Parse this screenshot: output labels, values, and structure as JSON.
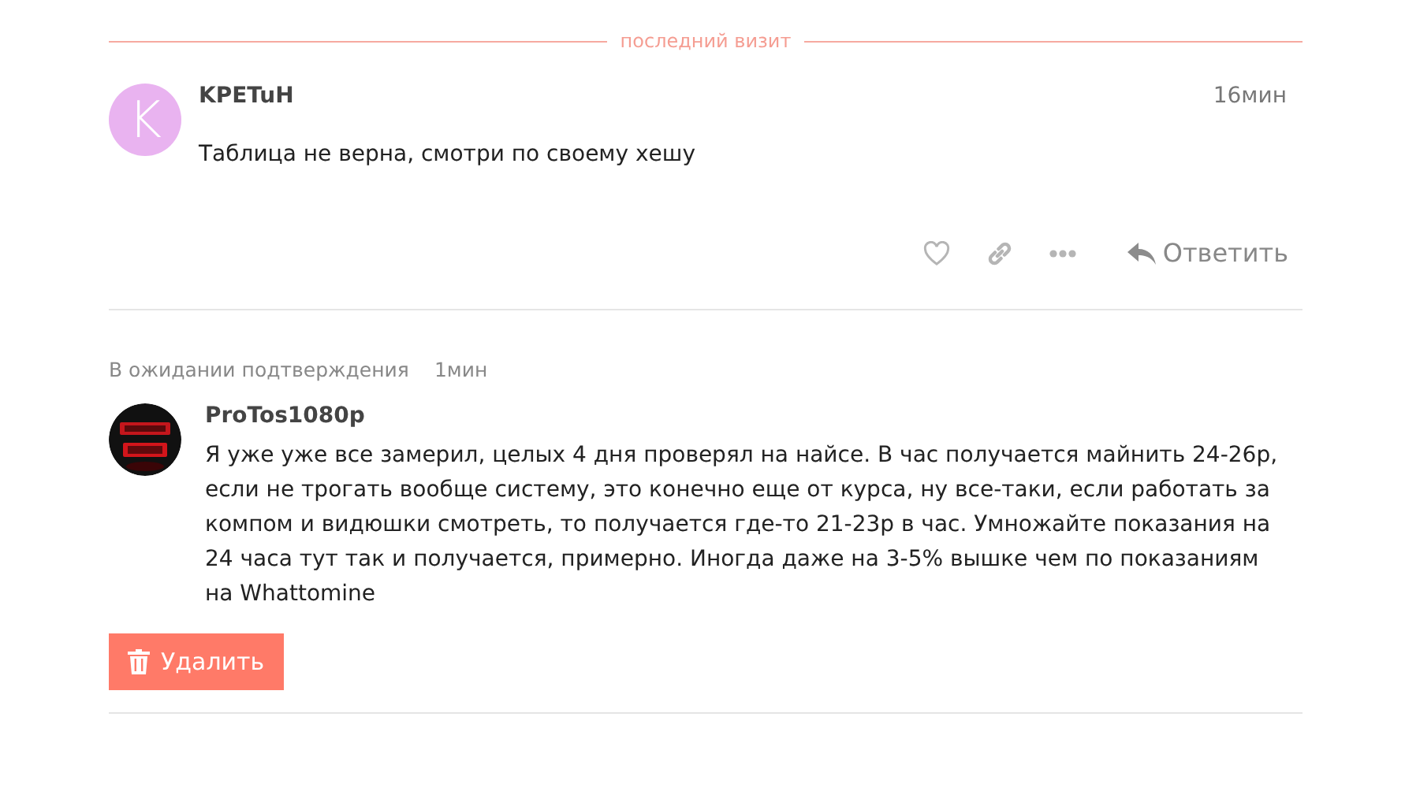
{
  "separator": {
    "label": "последний визит"
  },
  "posts": [
    {
      "kind": "comment",
      "avatar": {
        "kind": "letter",
        "letter": "K",
        "color": "#e9b3f0"
      },
      "author": "KPETuH",
      "time": "16мин",
      "body": "Таблица не верна, смотри по своему хешу",
      "actions": {
        "reply": "Ответить"
      }
    },
    {
      "kind": "pending",
      "status": "В ожидании подтверждения",
      "time": "1мин",
      "author": "ProTos1080p",
      "body": "Я уже уже все замерил, целых 4 дня проверял на найсе. В час получается майнить 24-26р, если не трогать вообще систему, это конечно еще от курса, ну все-таки, если работать за компом и видюшки смотреть, то получается где-то 21-23р в час. Умножайте показания на 24 часа тут так и получается, примерно. Иногда даже на 3-5% вышке чем по показаниям на Whattomine",
      "delete_button": "Удалить"
    }
  ]
}
